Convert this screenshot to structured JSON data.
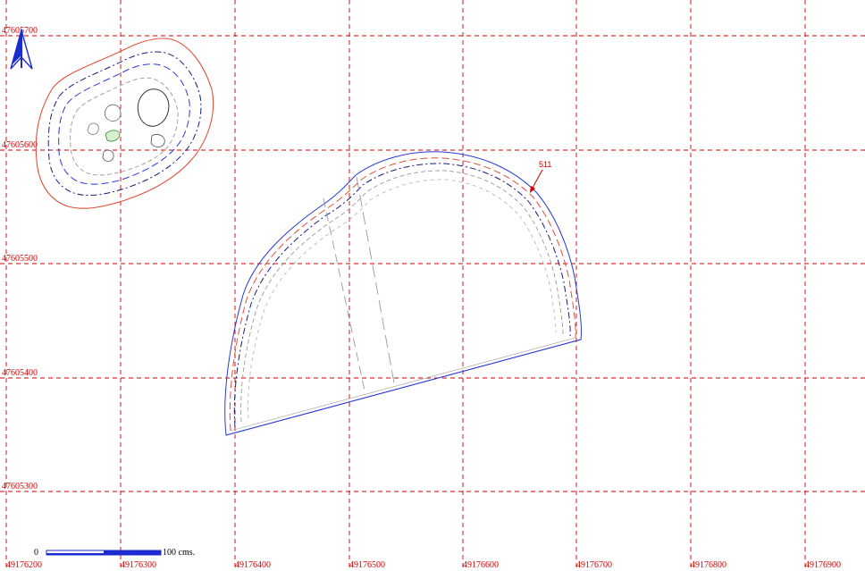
{
  "grid": {
    "x_labels": [
      "49176200",
      "49176300",
      "49176400",
      "49176500",
      "49176600",
      "49176700",
      "49176800",
      "49176900"
    ],
    "y_labels": [
      "47605700",
      "47605600",
      "47605500",
      "47605400",
      "47605300"
    ]
  },
  "scale_bar": {
    "start_label": "0",
    "end_label": "100 cms."
  },
  "marker": {
    "label": "511"
  },
  "colors": {
    "grid": "#d00000",
    "outline_blue": "#2a3ad8",
    "outline_red": "#e0503a",
    "contour_navy": "#1a1a7a",
    "contour_grey": "#9a9a9a",
    "north_arrow": "#1a2bd0"
  },
  "icons": {
    "north_arrow": "north-arrow-icon"
  }
}
